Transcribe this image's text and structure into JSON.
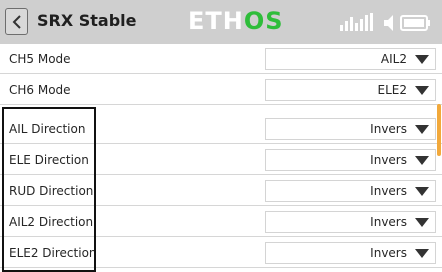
{
  "header": {
    "title": "SRX Stable",
    "logo_eth": "ETH",
    "logo_os": "OS",
    "back_icon": "chevron-left-icon",
    "status_icons": [
      "signal-bars-icon",
      "speaker-icon",
      "battery-icon"
    ]
  },
  "rows": [
    {
      "label": "CH5 Mode",
      "value": "AIL2"
    },
    {
      "label": "CH6 Mode",
      "value": "ELE2"
    },
    {
      "label": "AIL Direction",
      "value": "Invers"
    },
    {
      "label": "ELE Direction",
      "value": "Invers"
    },
    {
      "label": "RUD Direction",
      "value": "Invers"
    },
    {
      "label": "AIL2 Direction",
      "value": "Invers"
    },
    {
      "label": "ELE2 Direction",
      "value": "Invers"
    }
  ],
  "colors": {
    "header_bg": "#cfcfcf",
    "logo_accent": "#2ebd3a",
    "scroll_indicator": "#f2a93b",
    "highlight_border": "#111111"
  }
}
